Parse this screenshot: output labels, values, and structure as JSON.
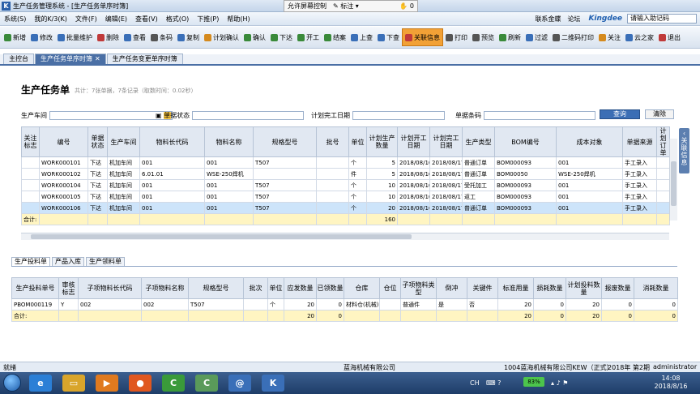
{
  "window": {
    "title": "生产任务管理系统 - [生产任务单序时簿]"
  },
  "remote_bar": {
    "allow_control": "允许屏幕控制",
    "gesture": "标注",
    "hand_count": "0"
  },
  "menu": {
    "items": [
      "系统(S)",
      "我的K/3(K)",
      "文件(F)",
      "编辑(E)",
      "查看(V)",
      "格式(O)",
      "下推(P)",
      "帮助(H)"
    ],
    "right_links": [
      "联系金蝶",
      "论坛"
    ],
    "brand": "Kingdee",
    "help_placeholder": "请输入助记码"
  },
  "toolbar": {
    "buttons": [
      {
        "label": "新增",
        "icon": "new-icon",
        "color": "#3a8a3a"
      },
      {
        "label": "修改",
        "icon": "edit-icon",
        "color": "#3a6fb8"
      },
      {
        "label": "批量维护",
        "icon": "batch-icon",
        "color": "#3a6fb8"
      },
      {
        "label": "删除",
        "icon": "delete-icon",
        "color": "#c03a3a"
      },
      {
        "label": "查看",
        "icon": "view-icon",
        "color": "#3a6fb8"
      },
      {
        "label": "条码",
        "icon": "barcode-icon",
        "color": "#555555"
      },
      {
        "label": "复制",
        "icon": "copy-icon",
        "color": "#3a6fb8"
      },
      {
        "label": "计划确认",
        "icon": "plan-confirm-icon",
        "color": "#d58a1e"
      },
      {
        "label": "确认",
        "icon": "confirm-icon",
        "color": "#3a8a3a"
      },
      {
        "label": "下达",
        "icon": "release-icon",
        "color": "#3a8a3a"
      },
      {
        "label": "开工",
        "icon": "start-icon",
        "color": "#3a8a3a"
      },
      {
        "label": "结案",
        "icon": "close-case-icon",
        "color": "#3a8a3a"
      },
      {
        "label": "上查",
        "icon": "up-query-icon",
        "color": "#3a6fb8"
      },
      {
        "label": "下查",
        "icon": "down-query-icon",
        "color": "#3a6fb8"
      },
      {
        "label": "关联信息",
        "icon": "link-info-icon",
        "color": "#c03a3a",
        "active": true
      },
      {
        "label": "打印",
        "icon": "print-icon",
        "color": "#555555"
      },
      {
        "label": "预览",
        "icon": "preview-icon",
        "color": "#555555"
      },
      {
        "label": "刷新",
        "icon": "refresh-icon",
        "color": "#3a8a3a"
      },
      {
        "label": "过滤",
        "icon": "filter-icon",
        "color": "#3a6fb8"
      },
      {
        "label": "二维码打印",
        "icon": "qrcode-icon",
        "color": "#555555"
      },
      {
        "label": "关注",
        "icon": "follow-icon",
        "color": "#d58a1e"
      },
      {
        "label": "云之家",
        "icon": "cloud-icon",
        "color": "#3a6fb8"
      },
      {
        "label": "退出",
        "icon": "exit-icon",
        "color": "#c03a3a"
      }
    ]
  },
  "tabs": [
    {
      "label": "主控台",
      "active": false
    },
    {
      "label": "生产任务单序时簿",
      "active": true,
      "close": "✕"
    },
    {
      "label": "生产任务变更单序时簿",
      "active": false
    }
  ],
  "side_tab": "关联信息",
  "page": {
    "title": "生产任务单",
    "stats": "共计：7张单据，7条记录（取数时间：0.02秒）"
  },
  "filters": {
    "workshop_label": "生产车间",
    "status_label": "单据状态",
    "plan_finish_label": "计划完工日期",
    "bill_no_label": "单据条码",
    "query_button": "查询",
    "clear_button": "清除"
  },
  "main_table": {
    "headers": [
      "关注标志",
      "编号",
      "单据状态",
      "生产车间",
      "物料长代码",
      "物料名称",
      "规格型号",
      "批号",
      "单位",
      "计划生产数量",
      "计划开工日期",
      "计划完工日期",
      "生产类型",
      "BOM编号",
      "成本对象",
      "单据来源",
      "计划订单"
    ],
    "rows": [
      [
        "",
        "WORK000101",
        "下达",
        "机加车间",
        "001",
        "001",
        "T507",
        "",
        "个",
        "5",
        "2018/08/16",
        "2018/08/17",
        "普通订单",
        "BOM000093",
        "001",
        "手工录入",
        ""
      ],
      [
        "",
        "WORK000102",
        "下达",
        "机加车间",
        "6.01.01",
        "WSE-250焊机",
        "",
        "",
        "件",
        "5",
        "2018/08/16",
        "2018/08/17",
        "普通订单",
        "BOM00050",
        "WSE-250焊机",
        "手工录入",
        ""
      ],
      [
        "",
        "WORK000104",
        "下达",
        "机加车间",
        "001",
        "001",
        "T507",
        "",
        "个",
        "10",
        "2018/08/16",
        "2018/08/17",
        "受托加工",
        "BOM000093",
        "001",
        "手工录入",
        ""
      ],
      [
        "",
        "WORK000105",
        "下达",
        "机加车间",
        "001",
        "001",
        "T507",
        "",
        "个",
        "10",
        "2018/08/16",
        "2018/08/17",
        "返工",
        "BOM000093",
        "001",
        "手工录入",
        ""
      ],
      [
        "",
        "WORK000106",
        "下达",
        "机加车间",
        "001",
        "001",
        "T507",
        "",
        "个",
        "20",
        "2018/08/16",
        "2018/08/17",
        "普通订单",
        "BOM000093",
        "001",
        "手工录入",
        ""
      ]
    ],
    "selected_row": 4,
    "total_label": "合计:",
    "total_qty": "160"
  },
  "sub_tabs": [
    {
      "label": "生产投料单",
      "active": true
    },
    {
      "label": "产品入库",
      "active": false
    },
    {
      "label": "生产领料单",
      "active": false
    }
  ],
  "sub_table": {
    "headers": [
      "生产投料单号",
      "审核标志",
      "子项物料长代码",
      "子项物料名称",
      "规格型号",
      "批次",
      "单位",
      "应发数量",
      "已领数量",
      "仓库",
      "仓位",
      "子项物料类型",
      "倒冲",
      "关键件",
      "标准用量",
      "损耗数量",
      "计划投料数量",
      "报废数量",
      "消耗数量"
    ],
    "rows": [
      [
        "PBOM000119",
        "Y",
        "002",
        "002",
        "T507",
        "",
        "个",
        "20",
        "0",
        "材料仓(机械)",
        "",
        "普通件",
        "是",
        "否",
        "20",
        "0",
        "20",
        "0",
        "0"
      ]
    ],
    "total_label": "合计:",
    "total_values": [
      "",
      "",
      "",
      "",
      "",
      "",
      "",
      "20",
      "0",
      "",
      "",
      "",
      "",
      "",
      "20",
      "0",
      "20",
      "0",
      "0"
    ]
  },
  "statusbar": {
    "ready": "就绪",
    "company": "蓝海机械有限公司",
    "account": "1004蓝海机械有限公司KEW（正式）",
    "period": "2018年 第2期",
    "user": "administrator"
  },
  "taskbar": {
    "apps": [
      {
        "icon": "ie-icon",
        "glyph": "e",
        "color": "#2b7fd6"
      },
      {
        "icon": "explorer-icon",
        "glyph": "▭",
        "color": "#d9a52b"
      },
      {
        "icon": "media-player-icon",
        "glyph": "▶",
        "color": "#e07a1f"
      },
      {
        "icon": "firefox-icon",
        "glyph": "●",
        "color": "#e0571f"
      },
      {
        "icon": "camtasia-icon",
        "glyph": "C",
        "color": "#3a9a3a"
      },
      {
        "icon": "camtasia-recorder-icon",
        "glyph": "C",
        "color": "#5a9a5a"
      },
      {
        "icon": "mail-icon",
        "glyph": "@",
        "color": "#3a6fb8"
      },
      {
        "icon": "k3-icon",
        "glyph": "K",
        "color": "#3a6fb8"
      }
    ],
    "lang": "CH",
    "battery": "83%",
    "time": "14:08",
    "date": "2018/8/16"
  },
  "colors": {
    "accent": "#4a6fa5",
    "active_tool": "#f2a136",
    "selected_row": "#cde4fa",
    "total_row": "#fff5c2"
  }
}
